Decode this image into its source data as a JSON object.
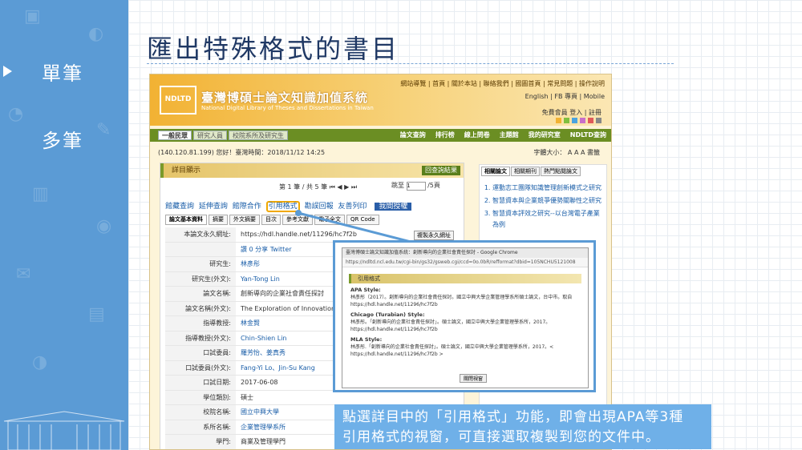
{
  "slide": {
    "title": "匯出特殊格式的書目",
    "sidebar": {
      "items": [
        {
          "label": "單筆"
        },
        {
          "label": "多筆"
        }
      ]
    },
    "caption_line1": "點選詳目中的「引用格式」功能，即會出現APA等3種",
    "caption_line2": "引用格式的視窗，可直接選取複製到您的文件中。",
    "colors": {
      "sidebar": "#5b9bd5",
      "title": "#1f3864",
      "caption_bg": "#6fb0e8",
      "highlight": "#f0a800"
    }
  },
  "site": {
    "logo_text": "NDLTD",
    "logo_sub": "IN TAIWAN",
    "name": "臺灣博碩士論文知識加值系統",
    "name_en": "National Digital Library of Theses and Dissertations in Taiwan",
    "top_links": "網站導覽 | 首頁 | 關於本站 | 聯絡我們 | 國圖首頁 | 常見問題 | 操作說明",
    "lang_links": "English | FB 專頁 | Mobile",
    "member_links": "免費會員 登入 | 註冊",
    "user_tabs": [
      {
        "label": "一般民眾"
      },
      {
        "label": "研究人員"
      },
      {
        "label": "校院系所及研究生"
      }
    ],
    "main_nav": [
      {
        "label": "論文查詢"
      },
      {
        "label": "排行榜"
      },
      {
        "label": "線上問卷"
      },
      {
        "label": "主題館"
      },
      {
        "label": "我的研究室"
      },
      {
        "label": "NDLTD查詢"
      }
    ],
    "info": "(140.120.81.199) 您好！臺灣時間：2018/11/12 14:25",
    "font_size": "字體大小：",
    "font_sizes": [
      {
        "label": "A"
      },
      {
        "label": "A"
      },
      {
        "label": "A"
      }
    ],
    "bookmark": "書籤"
  },
  "detail": {
    "panel_title": "詳目顯示",
    "back_label": "回查詢結果",
    "pager": "第 1 筆 / 共 5 筆",
    "jump_label": "跳至",
    "jump_value": "1",
    "jump_total": "/5頁",
    "actions": [
      {
        "label": "館藏查詢"
      },
      {
        "label": "延伸查詢"
      },
      {
        "label": "館際合作"
      },
      {
        "label": "引用格式"
      },
      {
        "label": "勘誤回報"
      },
      {
        "label": "友善列印"
      }
    ],
    "auth_label": "我間授權",
    "subtabs": [
      {
        "label": "論文基本資料"
      },
      {
        "label": "摘要"
      },
      {
        "label": "外文摘要"
      },
      {
        "label": "目次"
      },
      {
        "label": "參考文獻"
      },
      {
        "label": "電子全文"
      },
      {
        "label": "QR Code"
      }
    ],
    "rows": [
      {
        "k": "本論文永久網址:",
        "v": "https://hdl.handle.net/11296/hc7f2b"
      },
      {
        "k": "",
        "v": "讚 0   分享   Twitter"
      },
      {
        "k": "研究生:",
        "v": "林彥彤"
      },
      {
        "k": "研究生(外文):",
        "v": "Yan-Tong Lin"
      },
      {
        "k": "論文名稱:",
        "v": "創新導向的企業社會責任探討"
      },
      {
        "k": "論文名稱(外文):",
        "v": "The Exploration of Innovation-o"
      },
      {
        "k": "指導教授:",
        "v": "林金賢"
      },
      {
        "k": "指導教授(外文):",
        "v": "Chin-Shien Lin"
      },
      {
        "k": "口試委員:",
        "v": "羅芳怡、姜真秀"
      },
      {
        "k": "口試委員(外文):",
        "v": "Fang-Yi Lo、Jin-Su Kang"
      },
      {
        "k": "口試日期:",
        "v": "2017-06-08"
      },
      {
        "k": "學位類別:",
        "v": "碩士"
      },
      {
        "k": "校院名稱:",
        "v": "國立中興大學"
      },
      {
        "k": "系所名稱:",
        "v": "企業管理學系所"
      },
      {
        "k": "學門:",
        "v": "商業及管理學門"
      }
    ],
    "copy_button": "複製永久網址"
  },
  "related": {
    "tabs": [
      {
        "label": "相關論文"
      },
      {
        "label": "相關期刊"
      },
      {
        "label": "熱門點閱論文"
      }
    ],
    "items": [
      {
        "label": "運動志工團隊知識管理創新模式之研究"
      },
      {
        "label": "智慧資本與企業競爭優勢關聯性之研究"
      },
      {
        "label": "智慧資本評效之研究--以台灣電子產業為例"
      }
    ]
  },
  "popup": {
    "window_title": "臺灣博碩士論文知識加值系統：創新導向的企業社會責任探討 - Google Chrome",
    "url": "https://ndltd.ncl.edu.tw/cgi-bin/gs32/gsweb.cgi/ccd=0o.0bR/refformat?dbid=105NCHU5121008",
    "heading": "引用格式",
    "apa_title": "APA Style:",
    "apa_text": "林彥彤（2017）。創新導向的企業社會責任探討。國立中興大學企業管理學系所碩士論文，台中市。取自 https://hdl.handle.net/11296/hc7f2b",
    "chicago_title": "Chicago (Turabian) Style:",
    "chicago_text": "林彥彤。「創新導向的企業社會責任探討」。碩士論文，國立中興大學企業管理學系所，2017。https://hdl.handle.net/11296/hc7f2b",
    "mla_title": "MLA Style:",
    "mla_text": "林彥彤.「創新導向的企業社會責任探討」。碩士論文，國立中興大學企業管理學系所，2017。< https://hdl.handle.net/11296/hc7f2b >",
    "close_label": "關閉視窗"
  }
}
